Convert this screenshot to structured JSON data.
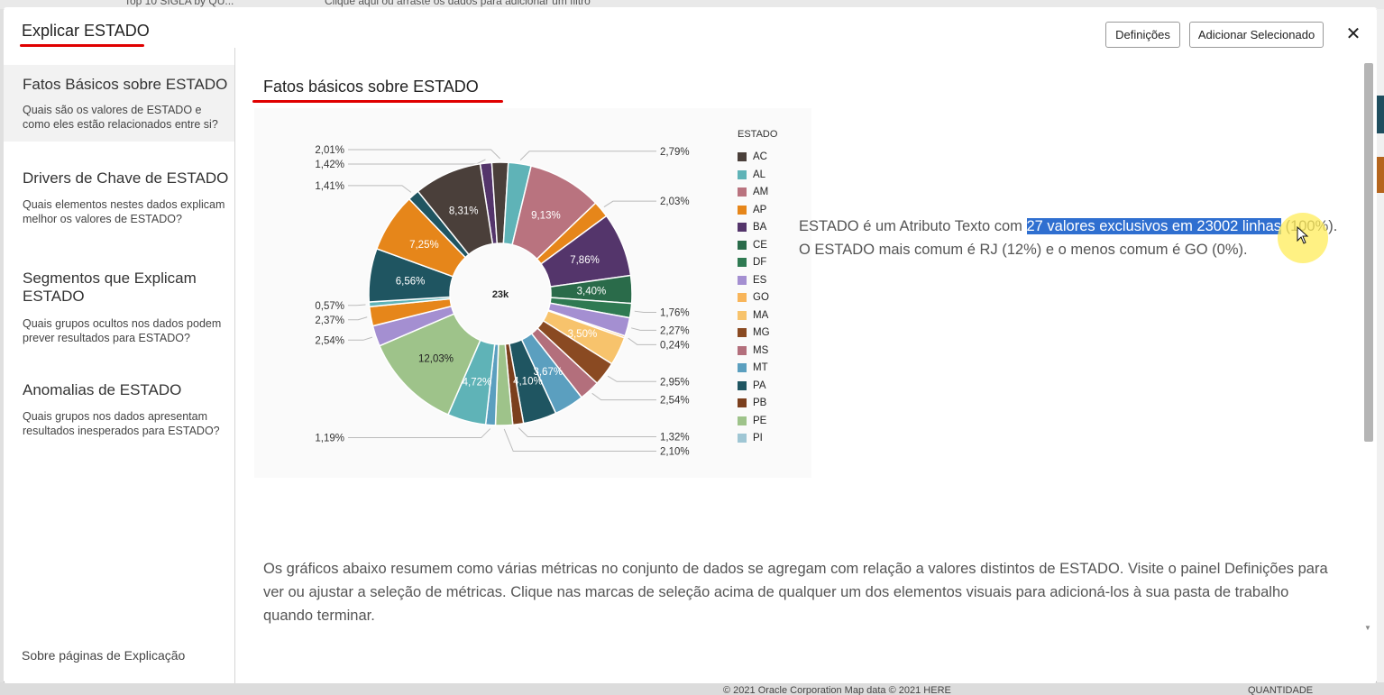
{
  "background": {
    "top_text": "Top 10 SIGLA by QU...",
    "filter_hint": "Clique aqui ou arraste os dados para adicionar um filtro",
    "footer_text": "© 2021 Oracle Corporation   Map data © 2021 HERE",
    "footer_right": "QUANTIDADE"
  },
  "modal": {
    "title": "Explicar ESTADO",
    "settings_button": "Definições",
    "add_selected_button": "Adicionar Selecionado",
    "close_icon": "close-icon"
  },
  "sidebar": {
    "items": [
      {
        "title": "Fatos Básicos sobre ESTADO",
        "desc": "Quais são os valores de ESTADO e como eles estão relacionados entre si?"
      },
      {
        "title": "Drivers de Chave de ESTADO",
        "desc": "Quais elementos nestes dados explicam melhor os valores de ESTADO?"
      },
      {
        "title": "Segmentos que Explicam ESTADO",
        "desc": "Quais grupos ocultos nos dados podem prever resultados para ESTADO?"
      },
      {
        "title": "Anomalias de ESTADO",
        "desc": "Quais grupos nos dados apresentam resultados inesperados para ESTADO?"
      }
    ],
    "footer": "Sobre páginas de Explicação"
  },
  "main": {
    "title": "Fatos básicos sobre ESTADO",
    "summary_before": "ESTADO é um Atributo Texto com ",
    "summary_highlight": "27 valores exclusivos em 23002 linhas",
    "summary_after": " (100%). O ESTADO mais comum é RJ (12%) e o menos comum é GO (0%).",
    "bottom_text": "Os gráficos abaixo resumem como várias métricas no conjunto de dados se agregam com relação a valores distintos de ESTADO. Visite o painel Definições para ver ou ajustar a seleção de métricas. Clique nas marcas de seleção acima de qualquer um dos elementos visuais para adicioná-los à sua pasta de trabalho quando terminar."
  },
  "chart_data": {
    "type": "pie",
    "donut": true,
    "center_label": "23k",
    "legend_title": "ESTADO",
    "legend_placement": "right",
    "legend": [
      {
        "label": "AC",
        "color": "#4a3f3a"
      },
      {
        "label": "AL",
        "color": "#5fb3b7"
      },
      {
        "label": "AM",
        "color": "#b9737f"
      },
      {
        "label": "AP",
        "color": "#e6861a"
      },
      {
        "label": "BA",
        "color": "#54356b"
      },
      {
        "label": "CE",
        "color": "#2a6b4a"
      },
      {
        "label": "DF",
        "color": "#2f7a52"
      },
      {
        "label": "ES",
        "color": "#a48fd1"
      },
      {
        "label": "GO",
        "color": "#f8b55a"
      },
      {
        "label": "MA",
        "color": "#f7c36c"
      },
      {
        "label": "MG",
        "color": "#8a4a22"
      },
      {
        "label": "MS",
        "color": "#b36f7c"
      },
      {
        "label": "MT",
        "color": "#5b9fbf"
      },
      {
        "label": "PA",
        "color": "#1f5561"
      },
      {
        "label": "PB",
        "color": "#7b3f1d"
      },
      {
        "label": "PE",
        "color": "#9ec38a"
      },
      {
        "label": "PI",
        "color": "#9fc6d4"
      }
    ],
    "slices": [
      {
        "value": 1.42,
        "color": "#54356b",
        "label": "1,42%"
      },
      {
        "value": 2.01,
        "color": "#4a3f3a",
        "label": "2,01%"
      },
      {
        "value": 2.79,
        "color": "#5fb3b7",
        "label": "2,79%"
      },
      {
        "value": 9.13,
        "color": "#b9737f",
        "label": "9,13%"
      },
      {
        "value": 2.03,
        "color": "#e6861a",
        "label": "2,03%"
      },
      {
        "value": 7.86,
        "color": "#54356b",
        "label": "7,86%"
      },
      {
        "value": 3.4,
        "color": "#2a6b4a",
        "label": "3,40%"
      },
      {
        "value": 1.76,
        "color": "#2f7a52",
        "label": "1,76%"
      },
      {
        "value": 2.27,
        "color": "#a48fd1",
        "label": "2,27%"
      },
      {
        "value": 0.24,
        "color": "#f8b55a",
        "label": "0,24%"
      },
      {
        "value": 3.5,
        "color": "#f7c36c",
        "label": "3,50%"
      },
      {
        "value": 2.95,
        "color": "#8a4a22",
        "label": "2,95%"
      },
      {
        "value": 2.54,
        "color": "#b36f7c",
        "label": "2,54%"
      },
      {
        "value": 3.67,
        "color": "#5b9fbf",
        "label": "3,67%"
      },
      {
        "value": 4.1,
        "color": "#1f5561",
        "label": "4,10%"
      },
      {
        "value": 1.32,
        "color": "#7b3f1d",
        "label": "1,32%"
      },
      {
        "value": 2.1,
        "color": "#9ec38a",
        "label": "2,10%"
      },
      {
        "value": 1.19,
        "color": "#5b9fbf",
        "label": "1,19%"
      },
      {
        "value": 4.72,
        "color": "#5fb3b7",
        "label": "4,72%"
      },
      {
        "value": 12.03,
        "color": "#9ec38a",
        "label": "12,03%"
      },
      {
        "value": 2.54,
        "color": "#a48fd1",
        "label": "2,54%"
      },
      {
        "value": 2.37,
        "color": "#e6861a",
        "label": "2,37%"
      },
      {
        "value": 0.57,
        "color": "#5fb3b7",
        "label": "0,57%"
      },
      {
        "value": 6.56,
        "color": "#1f5561",
        "label": "6,56%"
      },
      {
        "value": 7.25,
        "color": "#e6861a",
        "label": "7,25%"
      },
      {
        "value": 1.41,
        "color": "#1f5561",
        "label": "1,41%"
      },
      {
        "value": 8.31,
        "color": "#4a3f3a",
        "label": "8,31%"
      }
    ]
  }
}
